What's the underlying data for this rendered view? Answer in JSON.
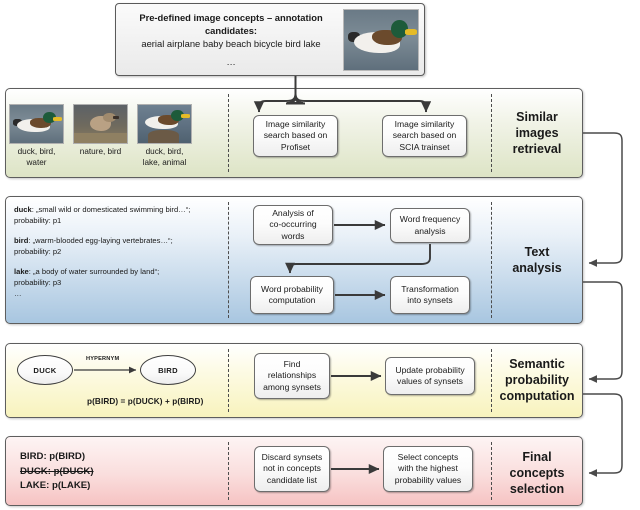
{
  "header": {
    "line1": "Pre-defined image concepts – annotation",
    "line2": "candidates:",
    "line3": "aerial airplane baby beach bicycle bird lake",
    "line4": "…",
    "thumbnail_name": "mallard-duck-photo"
  },
  "sections": [
    {
      "id": "similar-images-retrieval",
      "title_line1": "Similar",
      "title_line2": "images",
      "title_line3": "retrieval",
      "color": "#dde4c5"
    },
    {
      "id": "text-analysis",
      "title_line1": "Text",
      "title_line2": "analysis",
      "color": "#a8c6e0"
    },
    {
      "id": "semantic-probability-computation",
      "title_line1": "Semantic",
      "title_line2": "probability",
      "title_line3": "computation",
      "color": "#f8f3bd"
    },
    {
      "id": "final-concepts-selection",
      "title_line1": "Final",
      "title_line2": "concepts",
      "title_line3": "selection",
      "color": "#f6c3c3"
    }
  ],
  "similar_images": {
    "thumbnails": [
      {
        "name": "retrieved-image-duck",
        "caption": "duck, bird,\nwater"
      },
      {
        "name": "retrieved-image-sparrow",
        "caption": "nature, bird"
      },
      {
        "name": "retrieved-image-duck-lake",
        "caption": "duck, bird,\nlake, animal"
      }
    ],
    "steps": [
      {
        "name": "step-image-similarity-profiset",
        "label": "Image similarity\nsearch based on\nProfiset"
      },
      {
        "name": "step-image-similarity-scia",
        "label": "Image similarity\nsearch based on\nSCIA  trainset"
      }
    ]
  },
  "text_analysis": {
    "definitions": [
      {
        "word": "duck",
        "gloss": ": „small wild or domesticated swimming bird…“;",
        "probability": "probability: p1"
      },
      {
        "word": "bird",
        "gloss": ": „warm-blooded egg-laying vertebrates…“;",
        "probability": "probability: p2"
      },
      {
        "word": "lake",
        "gloss": ": „a body of water surrounded by land“;",
        "probability": "probability: p3"
      }
    ],
    "ellipsis": "…",
    "steps": [
      {
        "name": "step-analysis-cooccurring-words",
        "label": "Analysis of\nco-occurring\nwords"
      },
      {
        "name": "step-word-frequency-analysis",
        "label": "Word frequency\nanalysis"
      },
      {
        "name": "step-word-probability-computation",
        "label": "Word probability\ncomputation"
      },
      {
        "name": "step-transformation-into-synsets",
        "label": "Transformation\ninto synsets"
      }
    ]
  },
  "semantic": {
    "node_left": "DUCK",
    "node_right": "BIRD",
    "relation_label": "HYPERNYM",
    "formula": "p(BIRD) = p(DUCK) + p(BIRD)",
    "steps": [
      {
        "name": "step-find-relationships-among-synsets",
        "label": "Find\nrelationships\namong synsets"
      },
      {
        "name": "step-update-probability-values",
        "label": "Update probability\nvalues of synsets"
      }
    ]
  },
  "final": {
    "concepts": [
      {
        "label": "BIRD: p(BIRD)",
        "struck": false
      },
      {
        "label": "DUCK: p(DUCK)",
        "struck": true
      },
      {
        "label": "LAKE: p(LAKE)",
        "struck": false
      }
    ],
    "steps": [
      {
        "name": "step-discard-synsets",
        "label": "Discard synsets\nnot in concepts\ncandidate list"
      },
      {
        "name": "step-select-highest-probability-concepts",
        "label": "Select concepts\nwith the highest\nprobability values"
      }
    ]
  }
}
